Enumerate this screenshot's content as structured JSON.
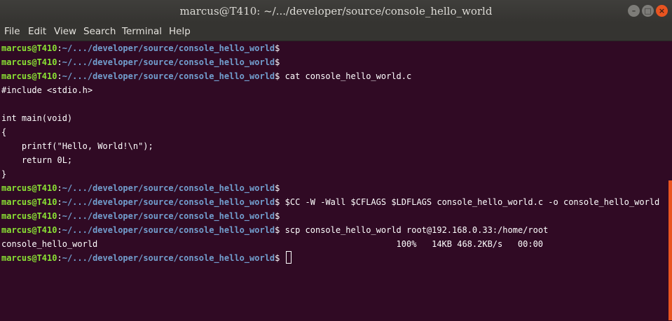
{
  "window": {
    "title": "marcus@T410: ~/.../developer/source/console_hello_world",
    "controls": {
      "minimize": "–",
      "maximize": "□",
      "close": "×"
    }
  },
  "menubar": {
    "items": [
      "File",
      "Edit",
      "View",
      "Search",
      "Terminal",
      "Help"
    ]
  },
  "terminal": {
    "prompt_user": "marcus@T410",
    "prompt_sep": ":",
    "prompt_path": "~/.../developer/source/console_hello_world",
    "prompt_symbol": "$",
    "lines": [
      {
        "type": "prompt",
        "command": ""
      },
      {
        "type": "prompt",
        "command": ""
      },
      {
        "type": "prompt",
        "command": " cat console_hello_world.c"
      },
      {
        "type": "output",
        "text": "#include <stdio.h>"
      },
      {
        "type": "output",
        "text": ""
      },
      {
        "type": "output",
        "text": "int main(void)"
      },
      {
        "type": "output",
        "text": "{"
      },
      {
        "type": "output",
        "text": "    printf(\"Hello, World!\\n\");"
      },
      {
        "type": "output",
        "text": "    return 0L;"
      },
      {
        "type": "output",
        "text": "}"
      },
      {
        "type": "prompt",
        "command": ""
      },
      {
        "type": "prompt",
        "command": " $CC -W -Wall $CFLAGS $LDFLAGS console_hello_world.c -o console_hello_world"
      },
      {
        "type": "prompt",
        "command": ""
      },
      {
        "type": "prompt",
        "command": " scp console_hello_world root@192.168.0.33:/home/root"
      },
      {
        "type": "output",
        "text": "console_hello_world                                                           100%   14KB 468.2KB/s   00:00"
      },
      {
        "type": "prompt",
        "command": " ",
        "cursor": true
      }
    ]
  },
  "colors": {
    "background": "#300a24",
    "prompt_user": "#8ae234",
    "prompt_path": "#729fcf",
    "text": "#ffffff",
    "scrollbar": "#e95420"
  }
}
